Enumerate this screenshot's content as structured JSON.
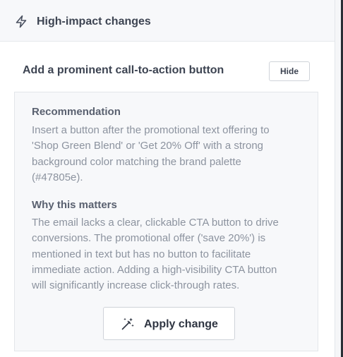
{
  "section": {
    "title": "High-impact changes",
    "icon": "lightning-bolt-icon"
  },
  "card": {
    "title": "Add a prominent call-to-action button",
    "hide_label": "Hide",
    "recommendation": {
      "heading": "Recommendation",
      "lines": [
        "Insert a button after the promotional text offering to",
        "'Shop Green Blend' or 'Get 20% Off' with a strong",
        "background color matching the brand palette",
        "(#47805e)."
      ]
    },
    "why": {
      "heading": "Why this matters",
      "lines": [
        "The email lacks a clear, clickable CTA button to drive",
        "conversions. The promotional offer ('save 20%') is",
        "mentioned in text but has no button to facilitate",
        "immediate action. Adding a high-visibility CTA button",
        "will significantly increase click-through rates."
      ]
    },
    "apply": {
      "label": "Apply change",
      "icon": "magic-wand-icon"
    }
  },
  "colors": {
    "header_bg": "#f7f8fa",
    "box_bg": "#f7f8fa",
    "border": "#e3e6ea",
    "heading_text": "#3d4452",
    "muted_text": "#8c939f"
  }
}
